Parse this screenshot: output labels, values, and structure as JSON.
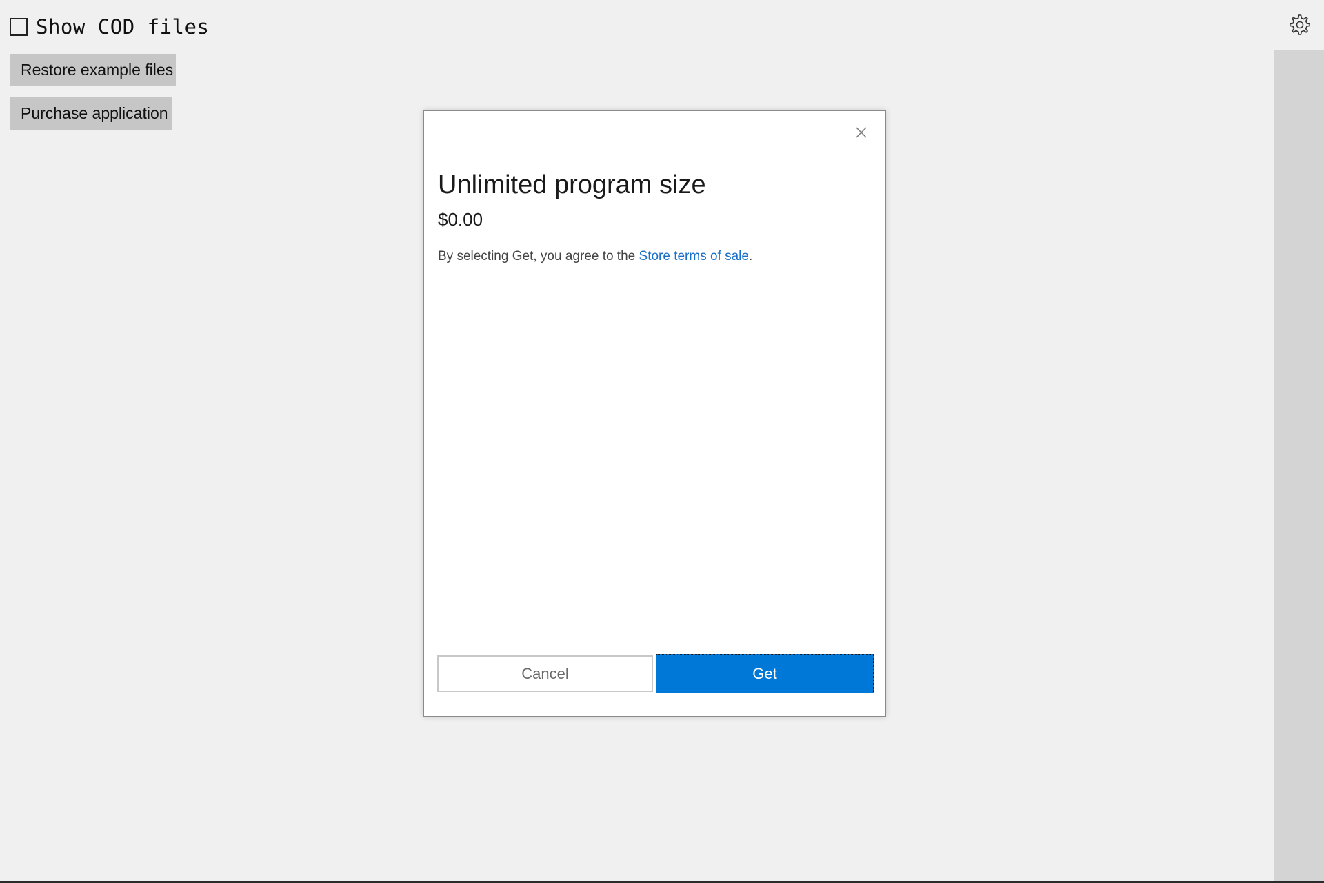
{
  "main": {
    "show_cod_label": "Show COD files",
    "show_cod_checked": false,
    "restore_label": "Restore example files",
    "purchase_label": "Purchase application",
    "settings_icon": "gear-icon"
  },
  "dialog": {
    "title": "Unlimited program size",
    "price": "$0.00",
    "terms_prefix": "By selecting Get, you agree to the ",
    "terms_link": "Store terms of sale",
    "terms_suffix": ".",
    "cancel_label": "Cancel",
    "get_label": "Get",
    "close_icon": "close-icon"
  },
  "colors": {
    "background": "#f0f0f0",
    "accent": "#0078d7",
    "link": "#1a6fc9",
    "button_gray": "#c6c6c6",
    "scrollbar": "#d4d4d4"
  }
}
